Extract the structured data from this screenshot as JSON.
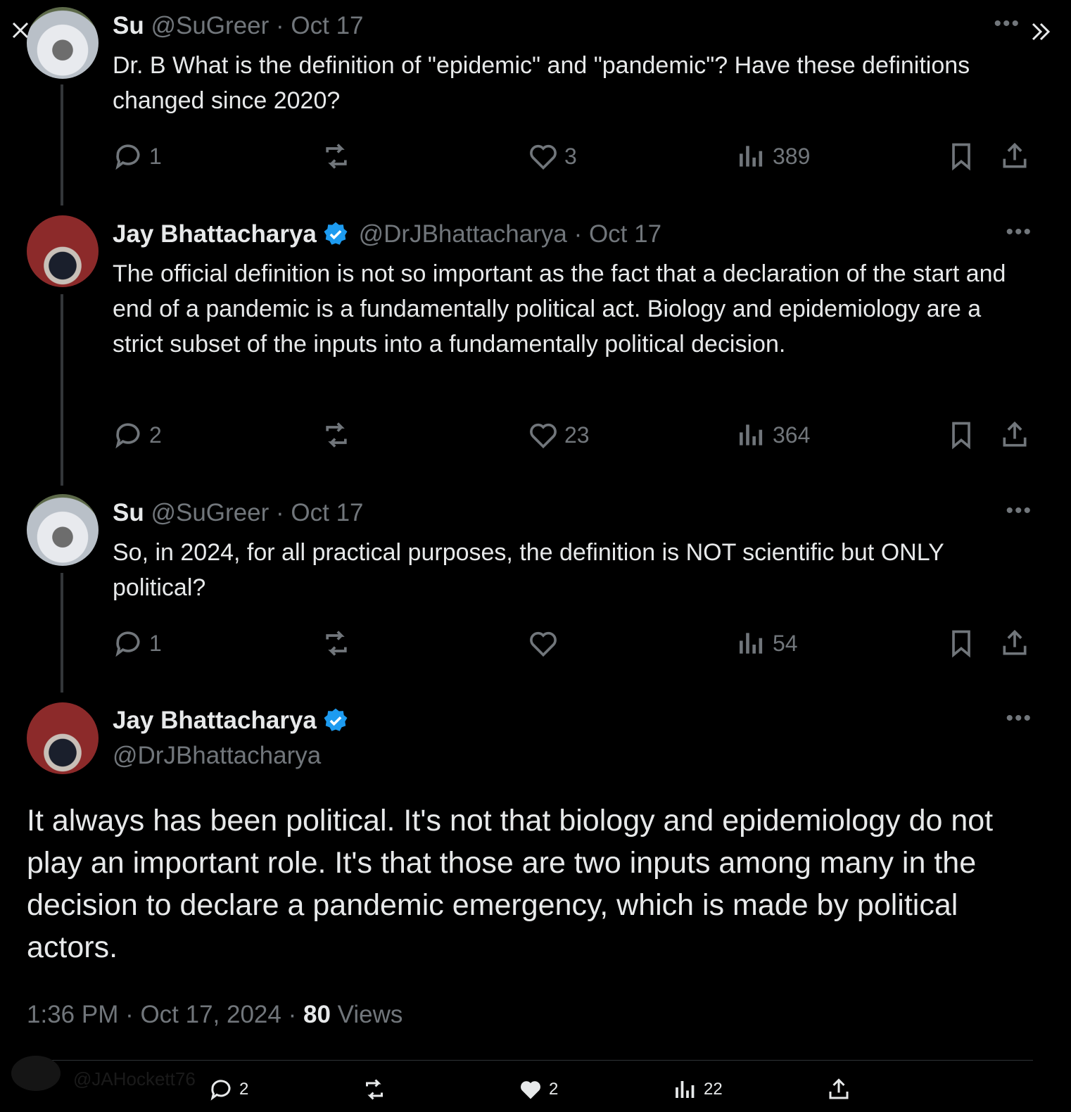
{
  "controls": {
    "close_icon": "close-icon",
    "expand_icon": "double-chevron-right-icon"
  },
  "tweets": [
    {
      "name": "Su",
      "handle": "@SuGreer",
      "date": "· Oct 17",
      "text": "Dr. B What is the definition of \"epidemic\" and \"pandemic\"? Have these definitions changed since 2020?",
      "replies": "1",
      "retweets": "",
      "likes": "3",
      "views": "389"
    },
    {
      "name": "Jay Bhattacharya",
      "handle": "@DrJBhattacharya",
      "date": "· Oct 17",
      "text": "The official definition is not so important as the fact that a declaration of the start and end of a pandemic is a fundamentally political act. Biology and epidemiology are a strict subset of the inputs into a fundamentally political decision.",
      "replies": "2",
      "retweets": "",
      "likes": "23",
      "views": "364"
    },
    {
      "name": "Su",
      "handle": "@SuGreer",
      "date": "· Oct 17",
      "text": "So, in 2024, for all practical purposes, the definition is NOT scientific but ONLY political?",
      "replies": "1",
      "retweets": "",
      "likes": "",
      "views": "54"
    }
  ],
  "main_tweet": {
    "name": "Jay Bhattacharya",
    "handle": "@DrJBhattacharya",
    "text": "It always has been political. It's not that biology and epidemiology do not play an important role. It's that those are two inputs among many in the decision to declare a pandemic emergency, which is made by political actors.",
    "time": "1:36 PM · Oct 17, 2024 ·",
    "views_count": "80",
    "views_label": "Views",
    "replies": "2",
    "likes": "2",
    "views": "22"
  },
  "faded_reply_handle": "@JAHockett76",
  "colors": {
    "background": "#000000",
    "text": "#e7e9ea",
    "muted": "#71767b",
    "verified": "#1d9bf0"
  }
}
